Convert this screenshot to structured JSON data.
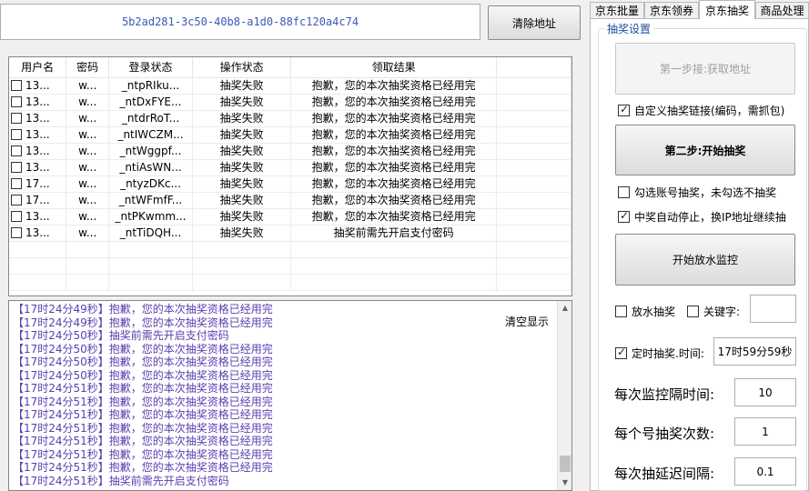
{
  "address": "5b2ad281-3c50-40b8-a1d0-88fc120a4c74",
  "clear_address_label": "清除地址",
  "table": {
    "headers": [
      "用户名",
      "密码",
      "登录状态",
      "操作状态",
      "领取结果"
    ],
    "rows": [
      {
        "user": "13...",
        "pwd": "w...",
        "login": "_ntpRIku...",
        "op": "抽奖失败",
        "result": "抱歉，您的本次抽奖资格已经用完"
      },
      {
        "user": "13...",
        "pwd": "w...",
        "login": "_ntDxFYE...",
        "op": "抽奖失败",
        "result": "抱歉，您的本次抽奖资格已经用完"
      },
      {
        "user": "13...",
        "pwd": "w...",
        "login": "_ntdrRoT...",
        "op": "抽奖失败",
        "result": "抱歉，您的本次抽奖资格已经用完"
      },
      {
        "user": "13...",
        "pwd": "w...",
        "login": "_ntIWCZM...",
        "op": "抽奖失败",
        "result": "抱歉，您的本次抽奖资格已经用完"
      },
      {
        "user": "13...",
        "pwd": "w...",
        "login": "_ntWggpf...",
        "op": "抽奖失败",
        "result": "抱歉，您的本次抽奖资格已经用完"
      },
      {
        "user": "13...",
        "pwd": "w...",
        "login": "_ntiAsWN...",
        "op": "抽奖失败",
        "result": "抱歉，您的本次抽奖资格已经用完"
      },
      {
        "user": "17...",
        "pwd": "w...",
        "login": "_ntyzDKc...",
        "op": "抽奖失败",
        "result": "抱歉，您的本次抽奖资格已经用完"
      },
      {
        "user": "17...",
        "pwd": "w...",
        "login": "_ntWFmfF...",
        "op": "抽奖失败",
        "result": "抱歉，您的本次抽奖资格已经用完"
      },
      {
        "user": "13...",
        "pwd": "w...",
        "login": "_ntPKwmm...",
        "op": "抽奖失败",
        "result": "抱歉，您的本次抽奖资格已经用完"
      },
      {
        "user": "13...",
        "pwd": "w...",
        "login": "_ntTiDQH...",
        "op": "抽奖失败",
        "result": "抽奖前需先开启支付密码"
      }
    ]
  },
  "log": {
    "clear_label": "清空显示",
    "lines": [
      "【17时24分49秒】抱歉，您的本次抽奖资格已经用完",
      "【17时24分49秒】抱歉，您的本次抽奖资格已经用完",
      "【17时24分50秒】抽奖前需先开启支付密码",
      "【17时24分50秒】抱歉，您的本次抽奖资格已经用完",
      "【17时24分50秒】抱歉，您的本次抽奖资格已经用完",
      "【17时24分50秒】抱歉，您的本次抽奖资格已经用完",
      "【17时24分51秒】抱歉，您的本次抽奖资格已经用完",
      "【17时24分51秒】抱歉，您的本次抽奖资格已经用完",
      "【17时24分51秒】抱歉，您的本次抽奖资格已经用完",
      "【17时24分51秒】抱歉，您的本次抽奖资格已经用完",
      "【17时24分51秒】抱歉，您的本次抽奖资格已经用完",
      "【17时24分51秒】抱歉，您的本次抽奖资格已经用完",
      "【17时24分51秒】抱歉，您的本次抽奖资格已经用完",
      "【17时24分51秒】抽奖前需先开启支付密码"
    ]
  },
  "tabs": [
    "京东批量",
    "京东领券",
    "京东抽奖",
    "商品处理"
  ],
  "settings": {
    "group_title": "抽奖设置",
    "step1_label": "第一步接:获取地址",
    "custom_link_label": "自定义抽奖链接(编码，需抓包)",
    "step2_label": "第二步:开始抽奖",
    "checked_only_label": "勾选账号抽奖，未勾选不抽奖",
    "auto_stop_label": "中奖自动停止，换IP地址继续抽",
    "monitor_label": "开始放水监控",
    "water_label": "放水抽奖",
    "keyword_label": "关键字:",
    "keyword_value": "",
    "timed_label": "定时抽奖.时间:",
    "timed_value": "17时59分59秒",
    "interval_label": "每次监控隔时间:",
    "interval_value": "10",
    "count_label": "每个号抽奖次数:",
    "count_value": "1",
    "delay_label": "每次抽延迟间隔:",
    "delay_value": "0.1"
  }
}
